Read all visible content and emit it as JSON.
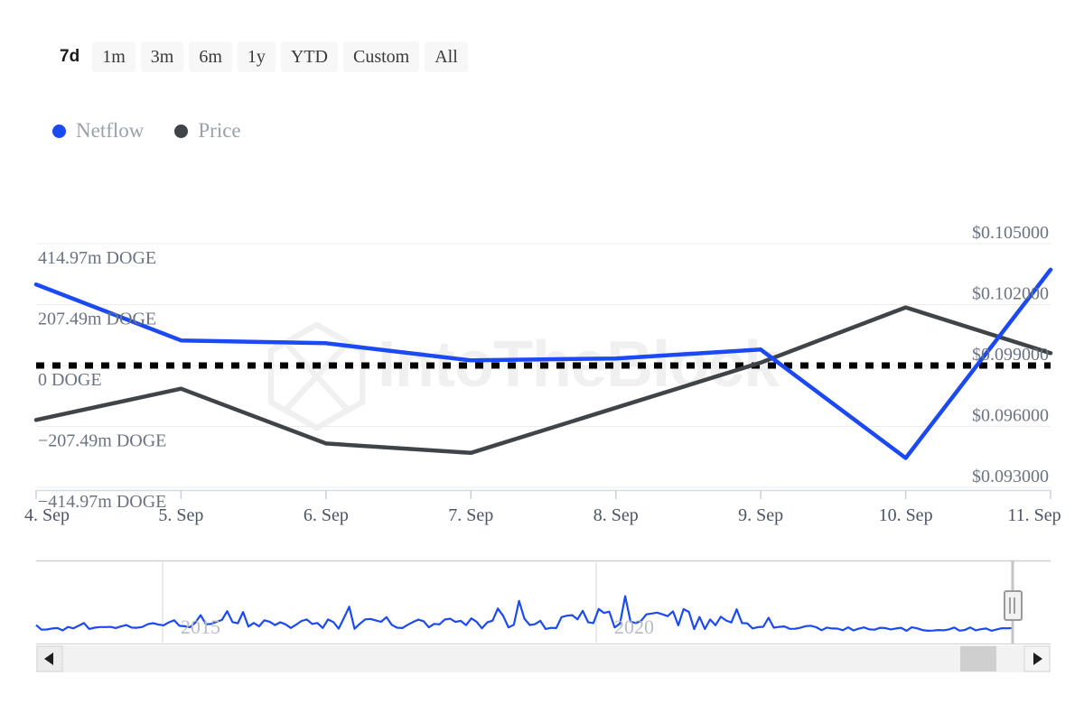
{
  "range_selector": {
    "options": [
      {
        "label": "7d",
        "active": true
      },
      {
        "label": "1m",
        "active": false
      },
      {
        "label": "3m",
        "active": false
      },
      {
        "label": "6m",
        "active": false
      },
      {
        "label": "1y",
        "active": false
      },
      {
        "label": "YTD",
        "active": false
      },
      {
        "label": "Custom",
        "active": false
      },
      {
        "label": "All",
        "active": false
      }
    ]
  },
  "legend": {
    "items": [
      {
        "label": "Netflow",
        "color": "#1b49f4"
      },
      {
        "label": "Price",
        "color": "#3f4448"
      }
    ]
  },
  "watermark": {
    "text": "IntoTheBlock",
    "color": "#f0f0f1"
  },
  "navigator": {
    "year_labels": [
      "2015",
      "2020"
    ],
    "series_color": "#1b49f4",
    "handle_label": "right-handle",
    "scrollbar": {
      "left_arrow": "◀",
      "right_arrow": "▶"
    }
  },
  "chart_data": {
    "type": "line",
    "title": "",
    "xlabel": "",
    "grid": true,
    "legend_position": "top-left",
    "x": [
      "4. Sep",
      "5. Sep",
      "6. Sep",
      "7. Sep",
      "8. Sep",
      "9. Sep",
      "10. Sep",
      "11. Sep"
    ],
    "axes": {
      "left": {
        "label": "Netflow",
        "unit": "DOGE",
        "tick_labels": [
          "414.97m DOGE",
          "207.49m DOGE",
          "0 DOGE",
          "−207.49m DOGE",
          "−414.97m DOGE"
        ],
        "tick_values": [
          414970000,
          207490000,
          0,
          -207490000,
          -414970000
        ],
        "ylim": [
          -518712500,
          518712500
        ]
      },
      "right": {
        "label": "Price",
        "unit": "USD",
        "tick_labels": [
          "$0.105000",
          "$0.102000",
          "$0.099000",
          "$0.096000",
          "$0.093000"
        ],
        "tick_values": [
          0.105,
          0.102,
          0.099,
          0.096,
          0.093
        ],
        "ylim": [
          0.0915,
          0.1065
        ]
      }
    },
    "zero_line": {
      "value": 0,
      "style": "dotted",
      "color": "#000000"
    },
    "series": [
      {
        "name": "Netflow",
        "axis": "left",
        "color": "#1b49f4",
        "unit": "DOGE",
        "values": [
          345000000,
          107000000,
          95000000,
          22000000,
          30000000,
          68000000,
          -394000000,
          408000000
        ]
      },
      {
        "name": "Price",
        "axis": "right",
        "color": "#3f4448",
        "unit": "USD",
        "values": [
          0.09565,
          0.09757,
          0.0942,
          0.09362,
          0.0964,
          0.09918,
          0.10258,
          0.09976
        ]
      }
    ]
  }
}
